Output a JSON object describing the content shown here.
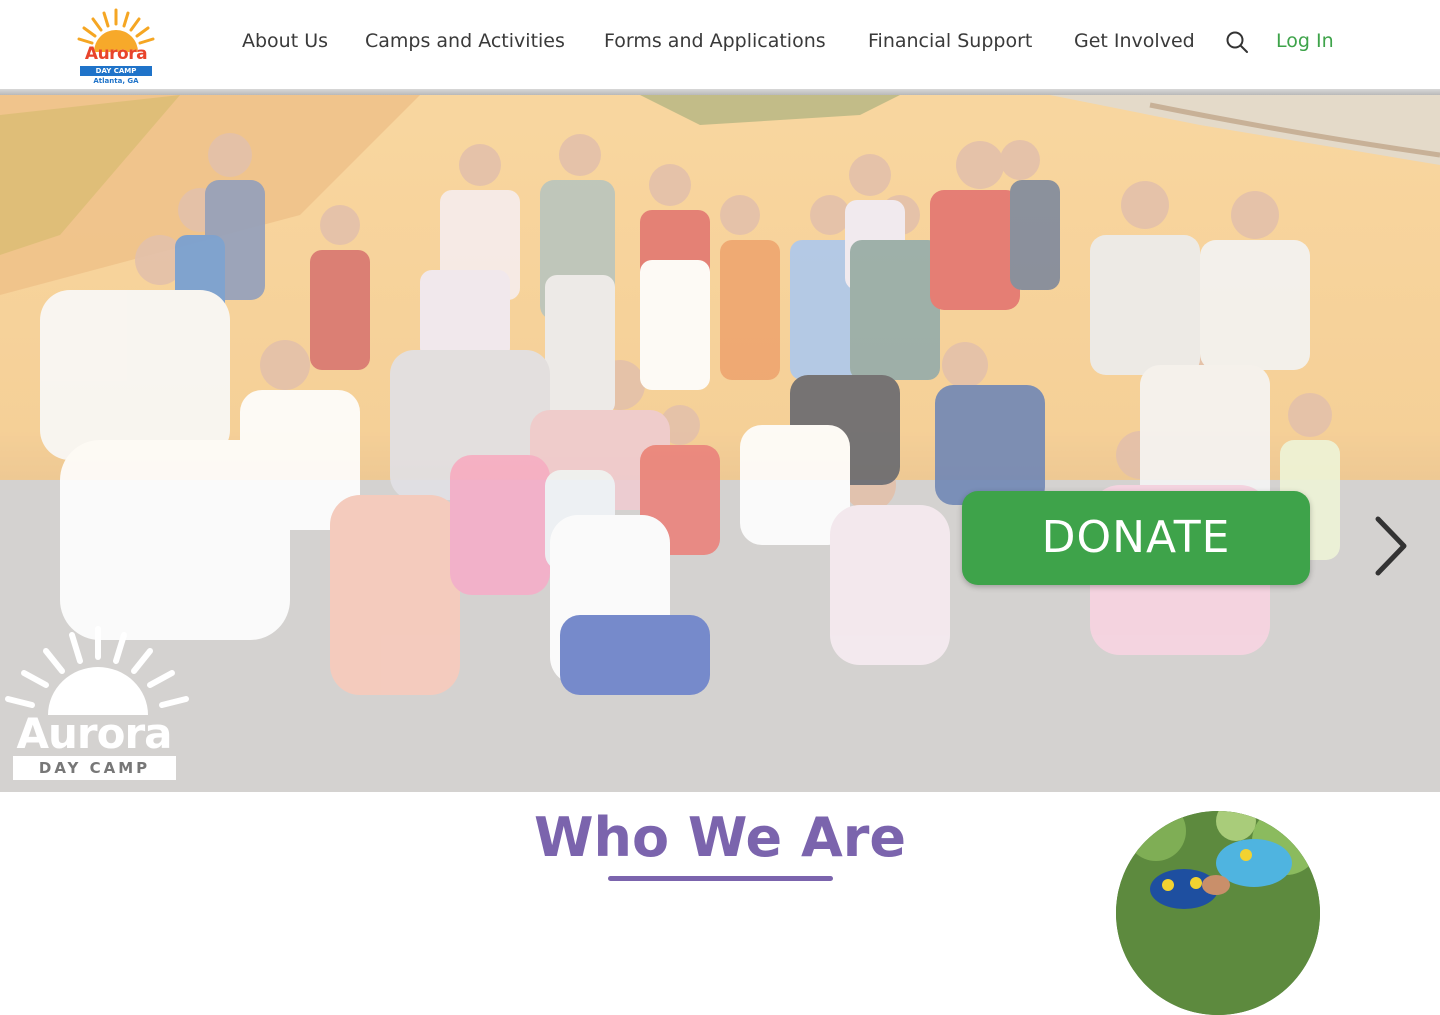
{
  "header": {
    "logo": {
      "word": "Aurora",
      "band": "DAY CAMP",
      "city": "Atlanta, GA"
    },
    "nav": [
      {
        "label": "About Us"
      },
      {
        "label": "Camps and Activities"
      },
      {
        "label": "Forms and Applications"
      },
      {
        "label": "Financial Support"
      },
      {
        "label": "Get Involved"
      }
    ],
    "search_icon": "search-icon",
    "login_label": "Log In"
  },
  "hero": {
    "donate_label": "DONATE",
    "next_icon": "chevron-right-icon",
    "watermark": {
      "word": "Aurora",
      "band": "DAY CAMP"
    }
  },
  "section": {
    "title": "Who We Are"
  },
  "colors": {
    "accent_green": "#3ea34a",
    "accent_purple": "#7b64ad",
    "logo_red": "#e8442c",
    "logo_blue": "#1f73c9",
    "nav_text": "#3a3a3a"
  }
}
